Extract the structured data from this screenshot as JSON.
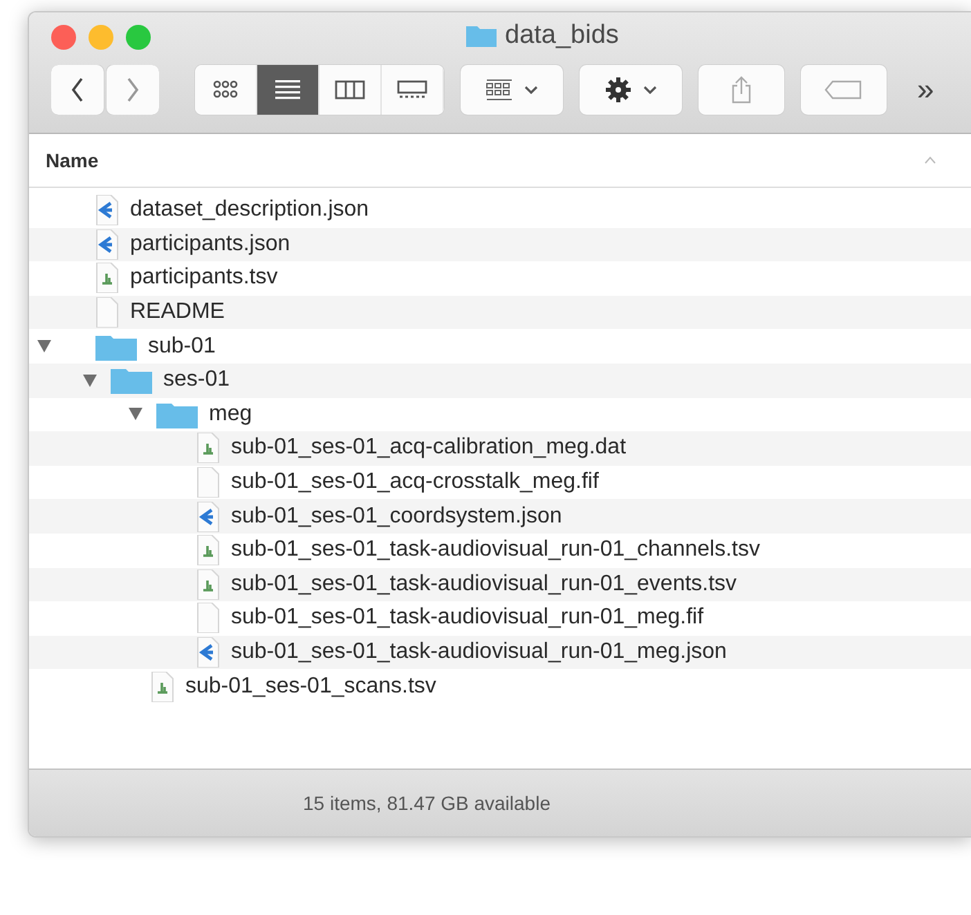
{
  "window": {
    "title": "data_bids"
  },
  "toolbar": {
    "view_modes": [
      {
        "selected": false
      },
      {
        "selected": true
      },
      {
        "selected": false
      },
      {
        "selected": false
      }
    ],
    "overflow": "»"
  },
  "column_header": "Name",
  "tree": [
    {
      "name": "dataset_description.json",
      "kind": "json"
    },
    {
      "name": "participants.json",
      "kind": "json"
    },
    {
      "name": "participants.tsv",
      "kind": "tsv"
    },
    {
      "name": "README",
      "kind": "document"
    },
    {
      "name": "sub-01",
      "kind": "folder",
      "expanded": true,
      "children": [
        {
          "name": "ses-01",
          "kind": "folder",
          "expanded": true,
          "children": [
            {
              "name": "meg",
              "kind": "folder",
              "expanded": true,
              "children": [
                {
                  "name": "sub-01_ses-01_acq-calibration_meg.dat",
                  "kind": "tsv"
                },
                {
                  "name": "sub-01_ses-01_acq-crosstalk_meg.fif",
                  "kind": "document"
                },
                {
                  "name": "sub-01_ses-01_coordsystem.json",
                  "kind": "json"
                },
                {
                  "name": "sub-01_ses-01_task-audiovisual_run-01_channels.tsv",
                  "kind": "tsv"
                },
                {
                  "name": "sub-01_ses-01_task-audiovisual_run-01_events.tsv",
                  "kind": "tsv"
                },
                {
                  "name": "sub-01_ses-01_task-audiovisual_run-01_meg.fif",
                  "kind": "document"
                },
                {
                  "name": "sub-01_ses-01_task-audiovisual_run-01_meg.json",
                  "kind": "json"
                }
              ]
            },
            {
              "name": "sub-01_ses-01_scans.tsv",
              "kind": "tsv"
            }
          ]
        }
      ]
    }
  ],
  "status_bar": "15 items, 81.47 GB available"
}
